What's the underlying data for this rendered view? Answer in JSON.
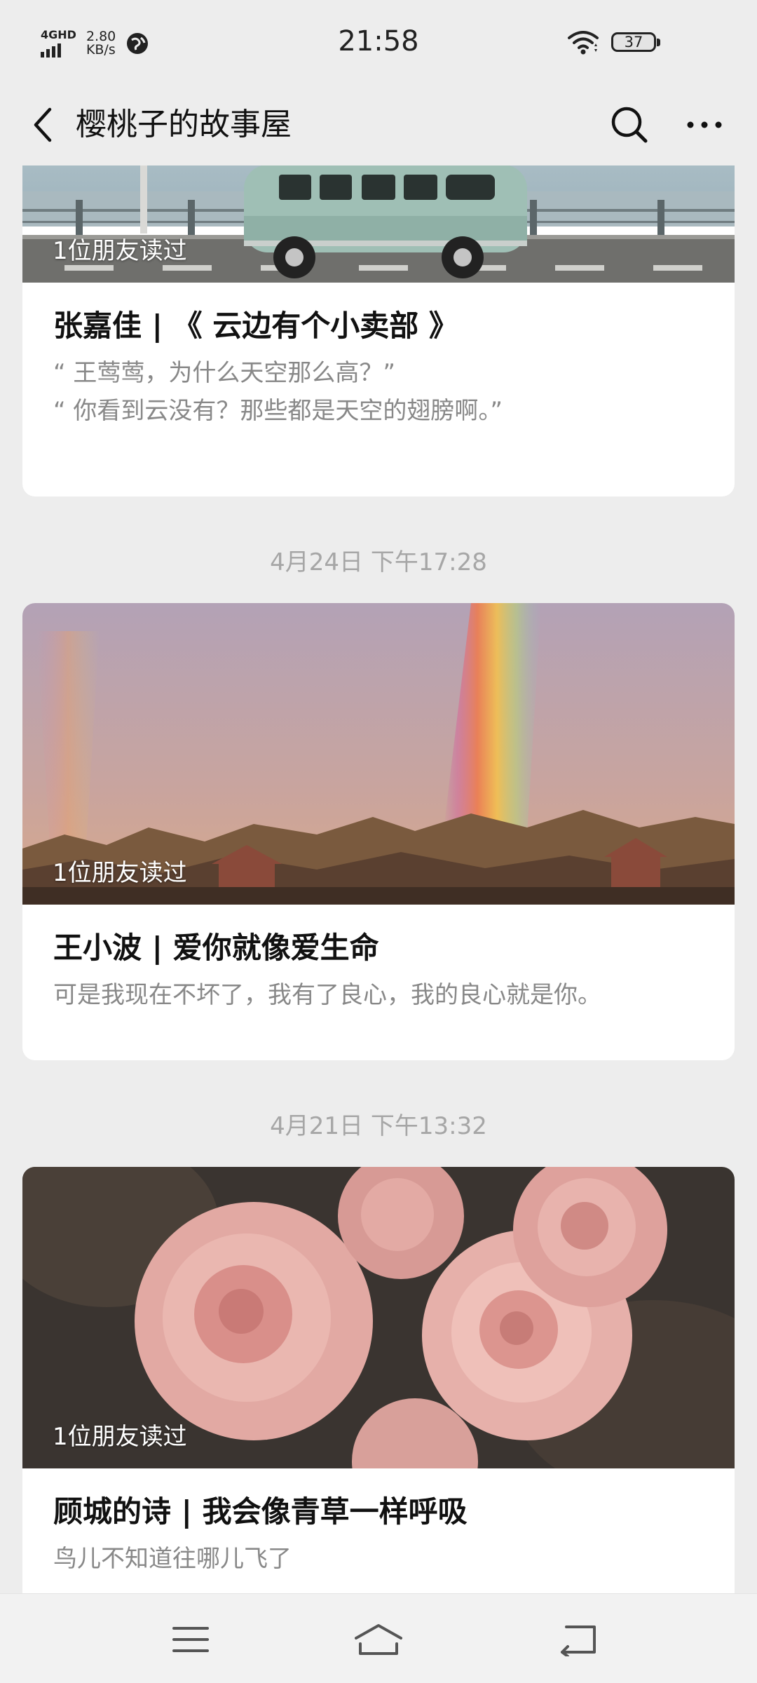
{
  "status_bar": {
    "network": "4GHD",
    "speed_value": "2.80",
    "speed_unit": "KB/s",
    "time": "21:58",
    "battery": "37"
  },
  "nav": {
    "title": "樱桃子的故事屋",
    "back_icon": "chevron-left-icon",
    "search_icon": "search-icon",
    "more_icon": "more-horizontal-icon"
  },
  "articles": [
    {
      "badge": "1位朋友读过",
      "title": "张嘉佳 | 《 云边有个小卖部 》",
      "excerpt": [
        "“ 王莺莺，为什么天空那么高？”",
        "“ 你看到云没有？那些都是天空的翅膀啊。”"
      ]
    },
    {
      "timestamp": "4月24日 下午17:28",
      "badge": "1位朋友读过",
      "title": "王小波 |  爱你就像爱生命",
      "excerpt": [
        "可是我现在不坏了，我有了良心，我的良心就是你。"
      ]
    },
    {
      "timestamp": "4月21日 下午13:32",
      "badge": "1位朋友读过",
      "title": "顾城的诗 | 我会像青草一样呼吸",
      "excerpt": [
        "鸟儿不知道往哪儿飞了"
      ]
    }
  ],
  "system_nav": {
    "menu_icon": "menu-icon",
    "home_icon": "home-icon",
    "back_icon": "back-arrow-icon"
  }
}
